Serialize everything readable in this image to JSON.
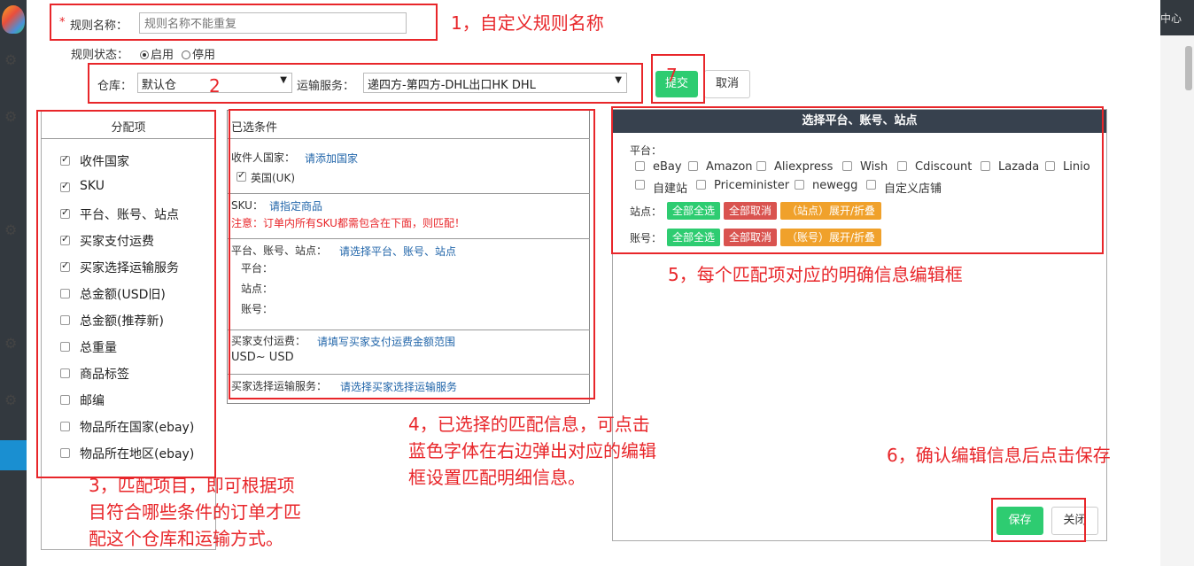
{
  "form": {
    "required_mark": "*",
    "rule_name_label": "规则名称：",
    "rule_name_placeholder": "规则名称不能重复",
    "status_label": "规则状态：",
    "status_enabled": "启用",
    "status_disabled": "停用",
    "warehouse_label": "仓库：",
    "warehouse_value": "默认仓",
    "shipping_label": "运输服务：",
    "shipping_value": "递四方-第四方-DHL出口HK DHL",
    "submit_button": "提交",
    "cancel_button": "取消"
  },
  "left_panel": {
    "title": "分配项",
    "items": [
      {
        "label": "收件国家",
        "checked": true
      },
      {
        "label": "SKU",
        "checked": true
      },
      {
        "label": "平台、账号、站点",
        "checked": true
      },
      {
        "label": "买家支付运费",
        "checked": true
      },
      {
        "label": "买家选择运输服务",
        "checked": true
      },
      {
        "label": "总金额(USD旧)",
        "checked": false
      },
      {
        "label": "总金额(推荐新)",
        "checked": false
      },
      {
        "label": "总重量",
        "checked": false
      },
      {
        "label": "商品标签",
        "checked": false
      },
      {
        "label": "邮编",
        "checked": false
      },
      {
        "label": "物品所在国家(ebay)",
        "checked": false
      },
      {
        "label": "物品所在地区(ebay)",
        "checked": false
      }
    ]
  },
  "middle_panel": {
    "title": "已选条件",
    "country_label": "收件人国家：",
    "country_link": "请添加国家",
    "country_value": "英国(UK)",
    "sku_label": "SKU：",
    "sku_link": "请指定商品",
    "sku_note": "注意：订单内所有SKU都需包含在下面，则匹配！",
    "platform_label": "平台、账号、站点：",
    "platform_link": "请选择平台、账号、站点",
    "platform_sub": "平台：",
    "site_sub": "站点：",
    "account_sub": "账号：",
    "payfee_label": "买家支付运费：",
    "payfee_link": "请填写买家支付运费金额范围",
    "payfee_value": "USD~ USD",
    "buyer_ship_label": "买家选择运输服务：",
    "buyer_ship_link": "请选择买家选择运输服务"
  },
  "right_panel": {
    "title": "选择平台、账号、站点",
    "platform_label": "平台：",
    "platforms": [
      "eBay",
      "Amazon",
      "Aliexpress",
      "Wish",
      "Cdiscount",
      "Lazada",
      "Linio",
      "自建站",
      "Priceminister",
      "newegg",
      "自定义店铺"
    ],
    "site_label": "站点：",
    "account_label": "账号：",
    "select_all": "全部全选",
    "cancel_all": "全部取消",
    "site_toggle": "（站点）展开/折叠",
    "account_toggle": "（账号）展开/折叠",
    "save_button": "保存",
    "close_button": "关闭"
  },
  "annotations": {
    "a1": "1，自定义规则名称",
    "a2": "2",
    "a3": [
      "3，匹配项目，即可根据项",
      "目符合哪些条件的订单才匹",
      "配这个仓库和运输方式。"
    ],
    "a4": [
      "4，已选择的匹配信息，可点击",
      "蓝色字体在右边弹出对应的编辑",
      "框设置匹配明细信息。"
    ],
    "a5": "5，每个匹配项对应的明确信息编辑框",
    "a6": "6，确认编辑信息后点击保存",
    "a7": "7"
  },
  "background": {
    "top_right_text": "中心"
  },
  "colors": {
    "annotation_red": "#e8262a",
    "green": "#2ecc71",
    "red": "#d9534f",
    "orange": "#f0a12b",
    "header_dark": "#37414e",
    "link_blue": "#2266aa"
  }
}
